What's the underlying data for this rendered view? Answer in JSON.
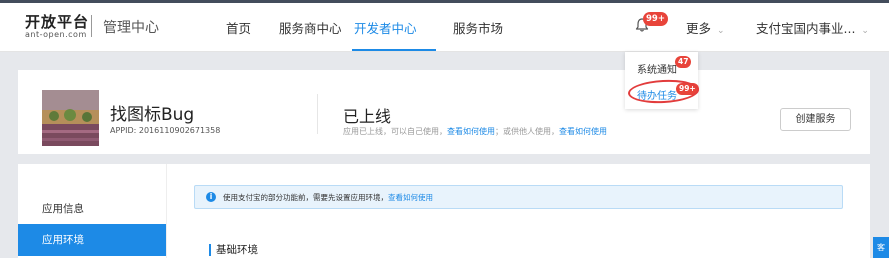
{
  "header": {
    "logo_main": "开放平台",
    "logo_sub": "ant-open.com",
    "console_title": "管理中心",
    "nav": [
      {
        "label": "首页"
      },
      {
        "label": "服务商中心"
      },
      {
        "label": "开发者中心",
        "active": true
      },
      {
        "label": "服务市场"
      }
    ],
    "bell_badge": "99+",
    "more_label": "更多",
    "account_label": "支付宝国内事业..."
  },
  "dropdown": {
    "items": [
      {
        "label": "系统通知",
        "badge": "47"
      },
      {
        "label": "待办任务",
        "badge": "99+"
      }
    ]
  },
  "app": {
    "name": "找图标Bug",
    "appid": "APPID: 2016110902671358",
    "status_title": "已上线",
    "status_desc_1": "应用已上线，可以自己使用，",
    "status_link_1": "查看如何使用",
    "status_desc_2": "；或供他人使用，",
    "status_link_2": "查看如何使用",
    "create_button": "创建服务"
  },
  "sidebar": {
    "items": [
      {
        "label": "应用信息"
      },
      {
        "label": "应用环境",
        "active": true
      }
    ]
  },
  "notice": {
    "icon": "i",
    "text": "使用支付宝的部分功能前，需要先设置应用环境，",
    "link": "查看如何使用"
  },
  "section": {
    "title": "基础环境"
  },
  "side_tab": {
    "label": "客"
  },
  "colors": {
    "accent": "#1d8ae6",
    "badge": "#e8443a",
    "highlight_ring": "#e23c3c",
    "page_bg": "#e6e8ec"
  }
}
